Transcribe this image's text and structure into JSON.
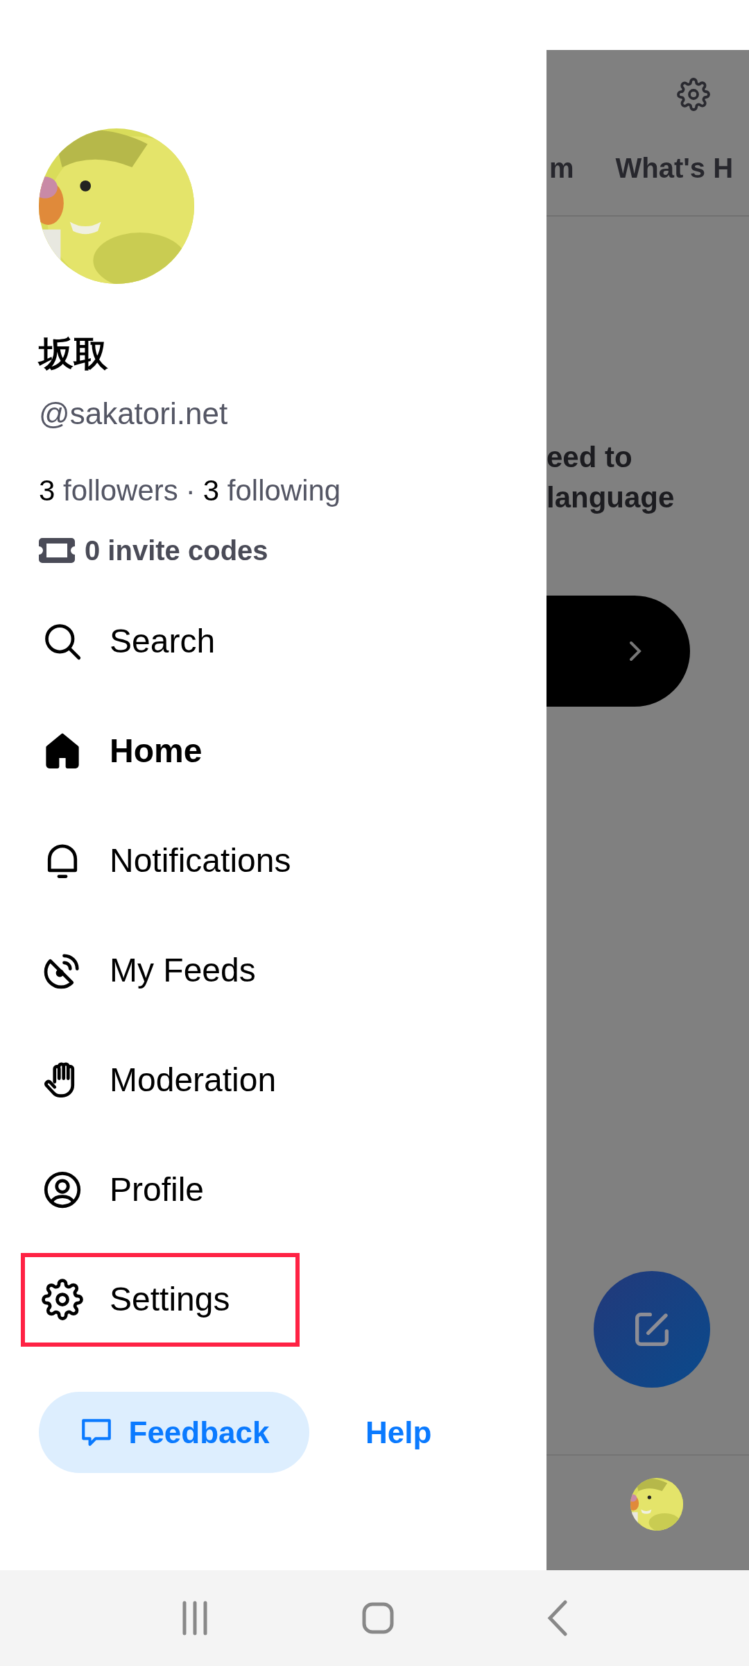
{
  "drawer": {
    "profile": {
      "display_name": "坂取",
      "handle": "@sakatori.net",
      "followers_count": "3",
      "followers_label": "followers",
      "separator": "·",
      "following_count": "3",
      "following_label": "following",
      "invite_codes": "0 invite codes"
    },
    "menu": [
      {
        "label": "Search",
        "selected": false,
        "highlighted": false
      },
      {
        "label": "Home",
        "selected": true,
        "highlighted": false
      },
      {
        "label": "Notifications",
        "selected": false,
        "highlighted": false
      },
      {
        "label": "My Feeds",
        "selected": false,
        "highlighted": false
      },
      {
        "label": "Moderation",
        "selected": false,
        "highlighted": false
      },
      {
        "label": "Profile",
        "selected": false,
        "highlighted": false
      },
      {
        "label": "Settings",
        "selected": false,
        "highlighted": true
      }
    ],
    "feedback_button": "Feedback",
    "help_link": "Help"
  },
  "background": {
    "tabs": [
      {
        "label": "m"
      },
      {
        "label": "What's H"
      }
    ],
    "message_lines": [
      "eed to",
      "language"
    ]
  }
}
